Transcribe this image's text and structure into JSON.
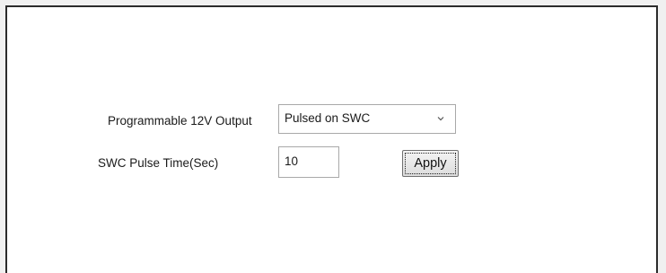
{
  "settings": {
    "output": {
      "label": "Programmable 12V Output",
      "selected": "Pulsed on SWC",
      "arrow_icon": "chevron-down-icon"
    },
    "pulse_time": {
      "label": "SWC Pulse Time(Sec)",
      "value": "10"
    },
    "apply_label": "Apply"
  }
}
